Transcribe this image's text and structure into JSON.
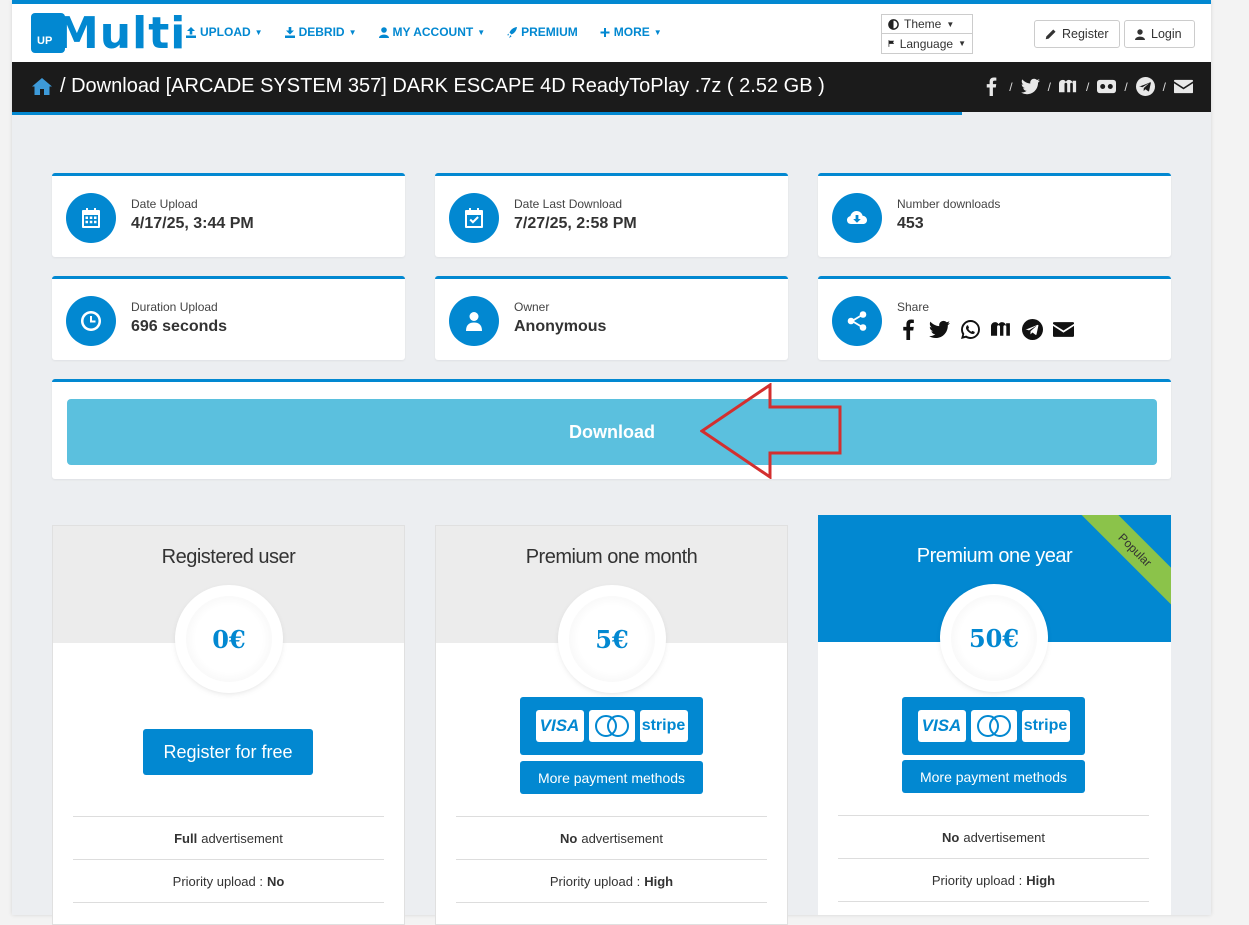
{
  "brand": {
    "logo_up": "UP",
    "logo_text": "Multi"
  },
  "nav": {
    "items": [
      {
        "label": "UPLOAD",
        "icon": "upload-icon"
      },
      {
        "label": "DEBRID",
        "icon": "download-icon"
      },
      {
        "label": "MY ACCOUNT",
        "icon": "user-icon"
      },
      {
        "label": "PREMIUM",
        "icon": "rocket-icon"
      },
      {
        "label": "MORE",
        "icon": "plus-icon"
      }
    ],
    "theme_label": "Theme",
    "language_label": "Language",
    "register_label": "Register",
    "login_label": "Login"
  },
  "titlebar": {
    "title": "/ Download [ARCADE SYSTEM 357] DARK ESCAPE 4D ReadyToPlay .7z ( 2.52 GB )",
    "share_icons": [
      "facebook-icon",
      "twitter-icon",
      "mix-icon",
      "vk-icon",
      "telegram-icon",
      "envelope-icon"
    ]
  },
  "info": {
    "date_upload": {
      "label": "Date Upload",
      "value": "4/17/25, 3:44 PM"
    },
    "date_last_download": {
      "label": "Date Last Download",
      "value": "7/27/25, 2:58 PM"
    },
    "number_downloads": {
      "label": "Number downloads",
      "value": "453"
    },
    "duration_upload": {
      "label": "Duration Upload",
      "value": "696 seconds"
    },
    "owner": {
      "label": "Owner",
      "value": "Anonymous"
    },
    "share": {
      "label": "Share"
    }
  },
  "download": {
    "label": "Download"
  },
  "plans": {
    "registered": {
      "title": "Registered user",
      "price": "0€",
      "cta": "Register for free",
      "ad_bold": "Full",
      "ad_text": "advertisement",
      "priority_label": "Priority upload :",
      "priority_value": "No"
    },
    "month": {
      "title": "Premium one month",
      "price": "5€",
      "more_payment": "More payment methods",
      "ad_bold": "No",
      "ad_text": "advertisement",
      "priority_label": "Priority upload :",
      "priority_value": "High"
    },
    "year": {
      "title": "Premium one year",
      "price": "50€",
      "more_payment": "More payment methods",
      "ribbon": "Popular",
      "ad_bold": "No",
      "ad_text": "advertisement",
      "priority_label": "Priority upload :",
      "priority_value": "High"
    },
    "payment_logos": {
      "visa": "VISA",
      "stripe": "stripe"
    }
  },
  "colors": {
    "primary": "#0288d1",
    "download_button": "#5bc0de",
    "ribbon": "#8bc34a",
    "annotation_arrow": "#d32f2f"
  }
}
